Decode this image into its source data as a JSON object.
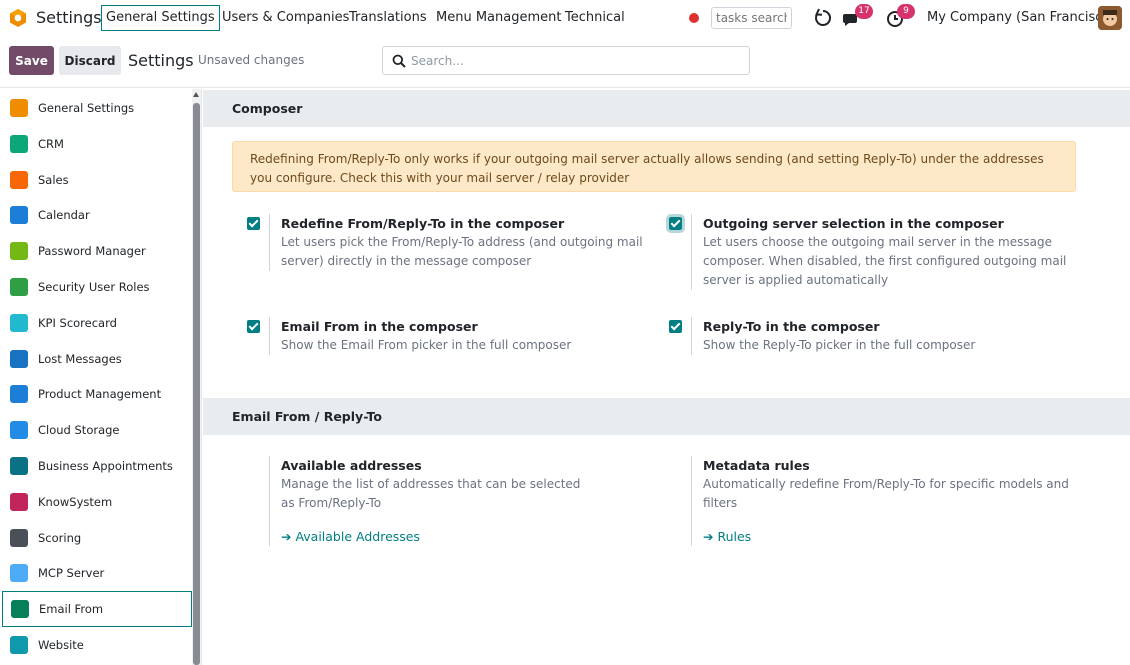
{
  "topnav": {
    "app_title": "Settings",
    "menu": [
      "General Settings",
      "Users & Companies",
      "Translations",
      "Menu Management",
      "Technical"
    ],
    "tasks_search_placeholder": "tasks search",
    "messages_count": "17",
    "activities_count": "9",
    "company": "My Company (San Francisco)"
  },
  "control_panel": {
    "save_label": "Save",
    "discard_label": "Discard",
    "title": "Settings",
    "unsaved": "Unsaved changes",
    "search_placeholder": "Search..."
  },
  "sidebar": {
    "items": [
      {
        "label": "General Settings",
        "icon": "settings-app-icon",
        "color": "#f08c00"
      },
      {
        "label": "CRM",
        "icon": "crm-icon",
        "color": "#0ca678"
      },
      {
        "label": "Sales",
        "icon": "sales-icon",
        "color": "#f76707"
      },
      {
        "label": "Calendar",
        "icon": "calendar-icon",
        "color": "#1c7ed6"
      },
      {
        "label": "Password Manager",
        "icon": "password-manager-icon",
        "color": "#74b816"
      },
      {
        "label": "Security User Roles",
        "icon": "security-roles-icon",
        "color": "#2f9e44"
      },
      {
        "label": "KPI Scorecard",
        "icon": "kpi-scorecard-icon",
        "color": "#22b8cf"
      },
      {
        "label": "Lost Messages",
        "icon": "lost-messages-icon",
        "color": "#1971c2"
      },
      {
        "label": "Product Management",
        "icon": "product-management-icon",
        "color": "#1c7ed6"
      },
      {
        "label": "Cloud Storage",
        "icon": "cloud-storage-icon",
        "color": "#228be6"
      },
      {
        "label": "Business Appointments",
        "icon": "appointments-icon",
        "color": "#0b7285"
      },
      {
        "label": "KnowSystem",
        "icon": "knowsystem-icon",
        "color": "#c2255c"
      },
      {
        "label": "Scoring",
        "icon": "scoring-icon",
        "color": "#495057"
      },
      {
        "label": "MCP Server",
        "icon": "mcp-server-icon",
        "color": "#4dabf7"
      },
      {
        "label": "Email From",
        "icon": "email-from-icon",
        "color": "#087f5b"
      },
      {
        "label": "Website",
        "icon": "website-icon",
        "color": "#1098ad"
      }
    ],
    "active_index": 14
  },
  "composer": {
    "heading": "Composer",
    "alert": "Redefining From/Reply-To only works if your outgoing mail server actually allows sending (and setting Reply-To) under the addresses you configure. Check this with your mail server / relay provider",
    "settings": [
      {
        "title": "Redefine From/Reply-To in the composer",
        "desc": "Let users pick the From/Reply-To address (and outgoing mail server) directly in the message composer",
        "checked": true
      },
      {
        "title": "Outgoing server selection in the composer",
        "desc": "Let users choose the outgoing mail server in the message composer. When disabled, the first configured outgoing mail server is applied automatically",
        "checked": true
      },
      {
        "title": "Email From in the composer",
        "desc": "Show the Email From picker in the full composer",
        "checked": true
      },
      {
        "title": "Reply-To in the composer",
        "desc": "Show the Reply-To picker in the full composer",
        "checked": true
      }
    ]
  },
  "email_from": {
    "heading": "Email From / Reply-To",
    "settings": [
      {
        "title": "Available addresses",
        "desc": "Manage the list of addresses that can be selected as From/Reply-To",
        "link": "Available Addresses"
      },
      {
        "title": "Metadata rules",
        "desc": "Automatically redefine From/Reply-To for specific models and filters",
        "link": "Rules"
      }
    ]
  },
  "colors": {
    "brand_primary": "#714b67",
    "accent_teal": "#017e84",
    "alert_bg": "#fde9c8"
  }
}
